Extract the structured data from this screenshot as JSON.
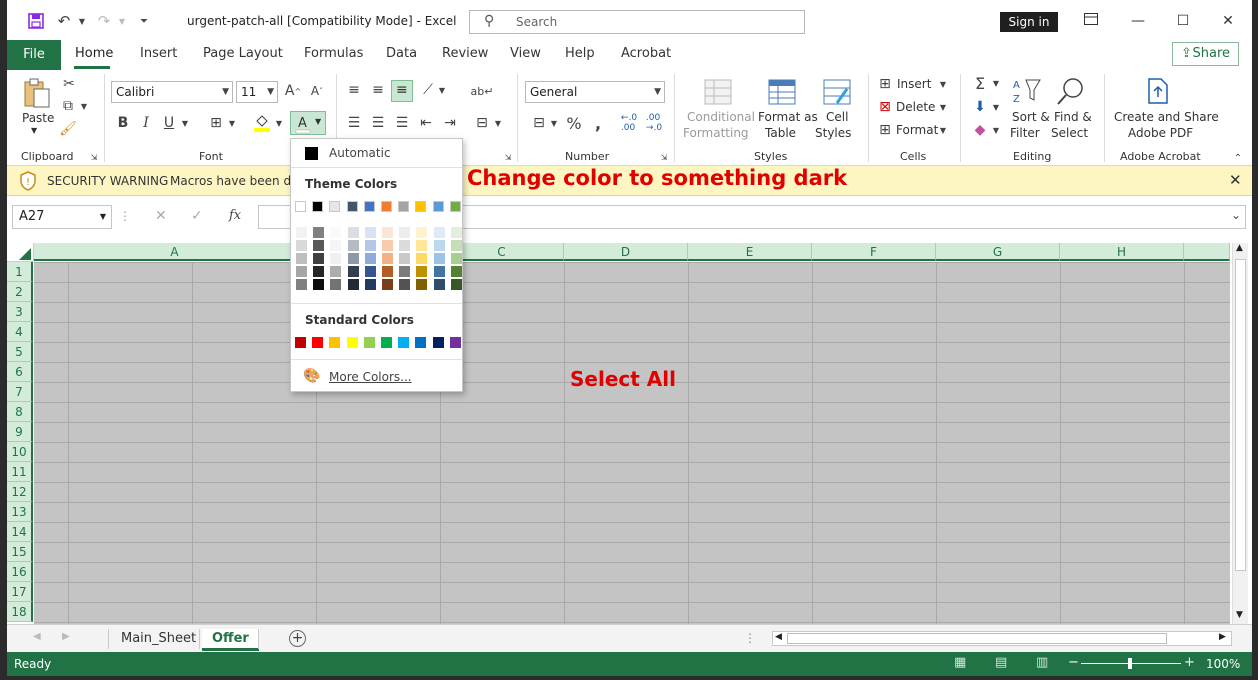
{
  "window": {
    "title": "urgent-patch-all  [Compatibility Mode]  -  Excel",
    "search_placeholder": "Search",
    "signin_label": "Sign in"
  },
  "ribbon_tabs": [
    "Home",
    "Insert",
    "Page Layout",
    "Formulas",
    "Data",
    "Review",
    "View",
    "Help",
    "Acrobat"
  ],
  "file_tab": "File",
  "share_label": "Share",
  "ribbon": {
    "clipboard": {
      "label": "Clipboard",
      "paste": "Paste"
    },
    "font": {
      "label": "Font",
      "name": "Calibri",
      "size": "11"
    },
    "alignment": {
      "label": ""
    },
    "number": {
      "label": "Number",
      "format": "General"
    },
    "styles": {
      "label": "Styles",
      "conditional_1": "Conditional",
      "conditional_2": "Formatting",
      "format_as_1": "Format as",
      "format_as_2": "Table",
      "cell_styles_1": "Cell",
      "cell_styles_2": "Styles"
    },
    "cells": {
      "label": "Cells",
      "insert": "Insert",
      "delete": "Delete",
      "format": "Format"
    },
    "editing": {
      "label": "Editing",
      "sort_1": "Sort &",
      "sort_2": "Filter",
      "find_1": "Find &",
      "find_2": "Select"
    },
    "acrobat": {
      "label": "Adobe Acrobat",
      "create_1": "Create and Share",
      "create_2": "Adobe PDF"
    }
  },
  "security": {
    "label": "SECURITY WARNING",
    "message": "Macros have been disa"
  },
  "annotations": {
    "top": "Change color to something dark",
    "middle": "Select All"
  },
  "formula_bar": {
    "name_box": "A27"
  },
  "columns": [
    "A",
    "B",
    "C",
    "D",
    "E",
    "F",
    "G",
    "H"
  ],
  "rows": [
    "1",
    "2",
    "3",
    "4",
    "5",
    "6",
    "7",
    "8",
    "9",
    "10",
    "11",
    "12",
    "13",
    "14",
    "15",
    "16",
    "17",
    "18"
  ],
  "sheets": {
    "tabs": [
      "Main_Sheet",
      "Offer"
    ],
    "active": "Offer"
  },
  "status": {
    "ready": "Ready",
    "zoom": "100%"
  },
  "color_menu": {
    "automatic": "Automatic",
    "theme_heading": "Theme Colors",
    "standard_heading": "Standard Colors",
    "more_colors": "More Colors...",
    "theme_colors": [
      "#ffffff",
      "#000000",
      "#e7e6e6",
      "#44546a",
      "#4472c4",
      "#ed7d31",
      "#a5a5a5",
      "#ffc000",
      "#5b9bd5",
      "#70ad47"
    ],
    "standard_colors": [
      "#c00000",
      "#ff0000",
      "#ffc000",
      "#ffff00",
      "#92d050",
      "#00b050",
      "#00b0f0",
      "#0070c0",
      "#002060",
      "#7030a0"
    ]
  },
  "colors": {
    "excel_green": "#217346",
    "selection_gray": "#c4c4c4",
    "annotation_red": "#e00000"
  }
}
